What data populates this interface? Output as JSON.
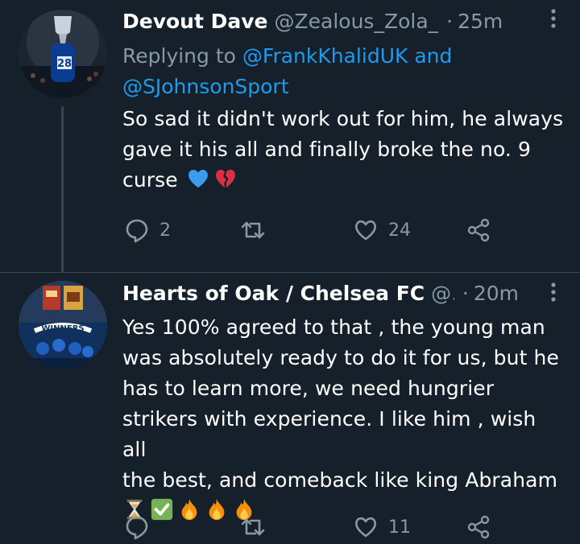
{
  "tweets": [
    {
      "display_name": "Devout Dave",
      "handle": "@Zealous_Zola_",
      "time": "25m",
      "replying_prefix": "Replying to ",
      "replying_to_1": "@FrankKhalidUK",
      "replying_and": " and",
      "replying_to_2": "@SJohnsonSport",
      "text_lines": [
        "So sad it didn't work out for him, he always",
        "gave it his all and finally broke the no. 9",
        "curse"
      ],
      "emojis": [
        "blue-heart-icon",
        "broken-heart-icon"
      ],
      "reply_count": "2",
      "retweet_count": "",
      "like_count": "24"
    },
    {
      "display_name": "Hearts of Oak / Chelsea FC",
      "handle": "@…",
      "time": "20m",
      "text_lines": [
        "Yes 100% agreed to that , the young man",
        "was absolutely ready to do it for us, but he",
        "has to learn more,  we need hungrier",
        "strikers with experience. I like him , wish all",
        "the best,  and comeback like king Abraham"
      ],
      "emojis": [
        "hourglass-icon",
        "check-mark-icon",
        "fire-icon",
        "fire-icon",
        "fire-icon"
      ],
      "reply_count": "",
      "retweet_count": "",
      "like_count": "11"
    }
  ],
  "colors": {
    "background": "#15202b",
    "secondary_text": "#8899a6",
    "link": "#1d9bf0",
    "divider": "#38444d"
  }
}
